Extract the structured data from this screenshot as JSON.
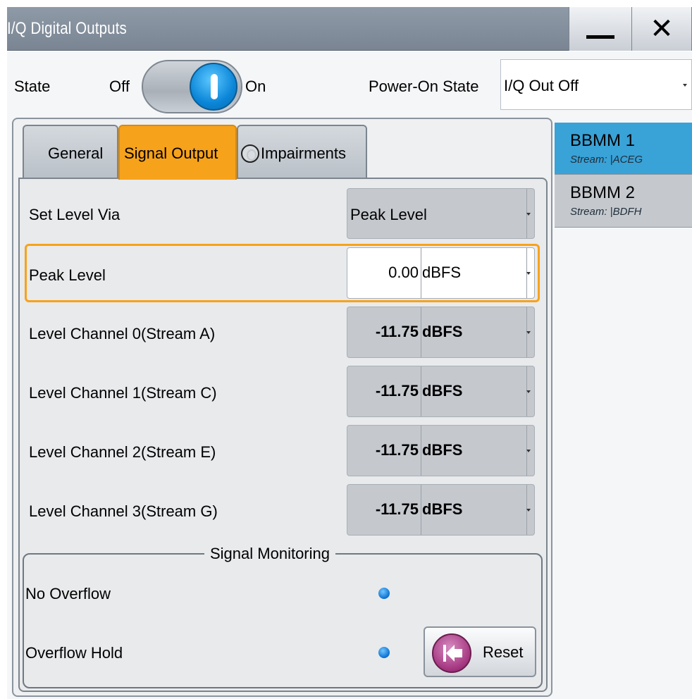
{
  "window": {
    "title": "I/Q Digital Outputs",
    "close_glyph": "✕"
  },
  "state": {
    "label": "State",
    "off_label": "Off",
    "on_label": "On",
    "value": "On"
  },
  "power_on_state": {
    "label": "Power-On State",
    "value": "I/Q Out Off"
  },
  "tabs": [
    {
      "label": "General",
      "active": false
    },
    {
      "label": "Signal Output",
      "active": true
    },
    {
      "label": "Impairments",
      "active": false
    }
  ],
  "set_level_via": {
    "label": "Set Level Via",
    "value": "Peak Level"
  },
  "peak_level": {
    "label": "Peak Level",
    "value": "0.00",
    "unit": "dBFS"
  },
  "level_channels": [
    {
      "label": "Level Channel 0(Stream A)",
      "value": "-11.75",
      "unit": "dBFS"
    },
    {
      "label": "Level Channel 1(Stream C)",
      "value": "-11.75",
      "unit": "dBFS"
    },
    {
      "label": "Level Channel 2(Stream E)",
      "value": "-11.75",
      "unit": "dBFS"
    },
    {
      "label": "Level Channel 3(Stream G)",
      "value": "-11.75",
      "unit": "dBFS"
    }
  ],
  "signal_monitoring": {
    "title": "Signal Monitoring",
    "no_overflow": "No Overflow",
    "overflow_hold": "Overflow Hold",
    "reset_label": "Reset"
  },
  "streams": [
    {
      "name": "BBMM 1",
      "sub": "Stream: |ACEG",
      "selected": true
    },
    {
      "name": "BBMM 2",
      "sub": "Stream: |BDFH",
      "selected": false
    }
  ],
  "colors": {
    "accent": "#f7a21b",
    "selected": "#39a2d7",
    "led": "#0b6fd0"
  },
  "icons": [
    "minimize-icon",
    "close-icon",
    "toggle-knob-icon",
    "impairments-radio-icon",
    "reset-arrow-icon",
    "status-led-icon"
  ]
}
